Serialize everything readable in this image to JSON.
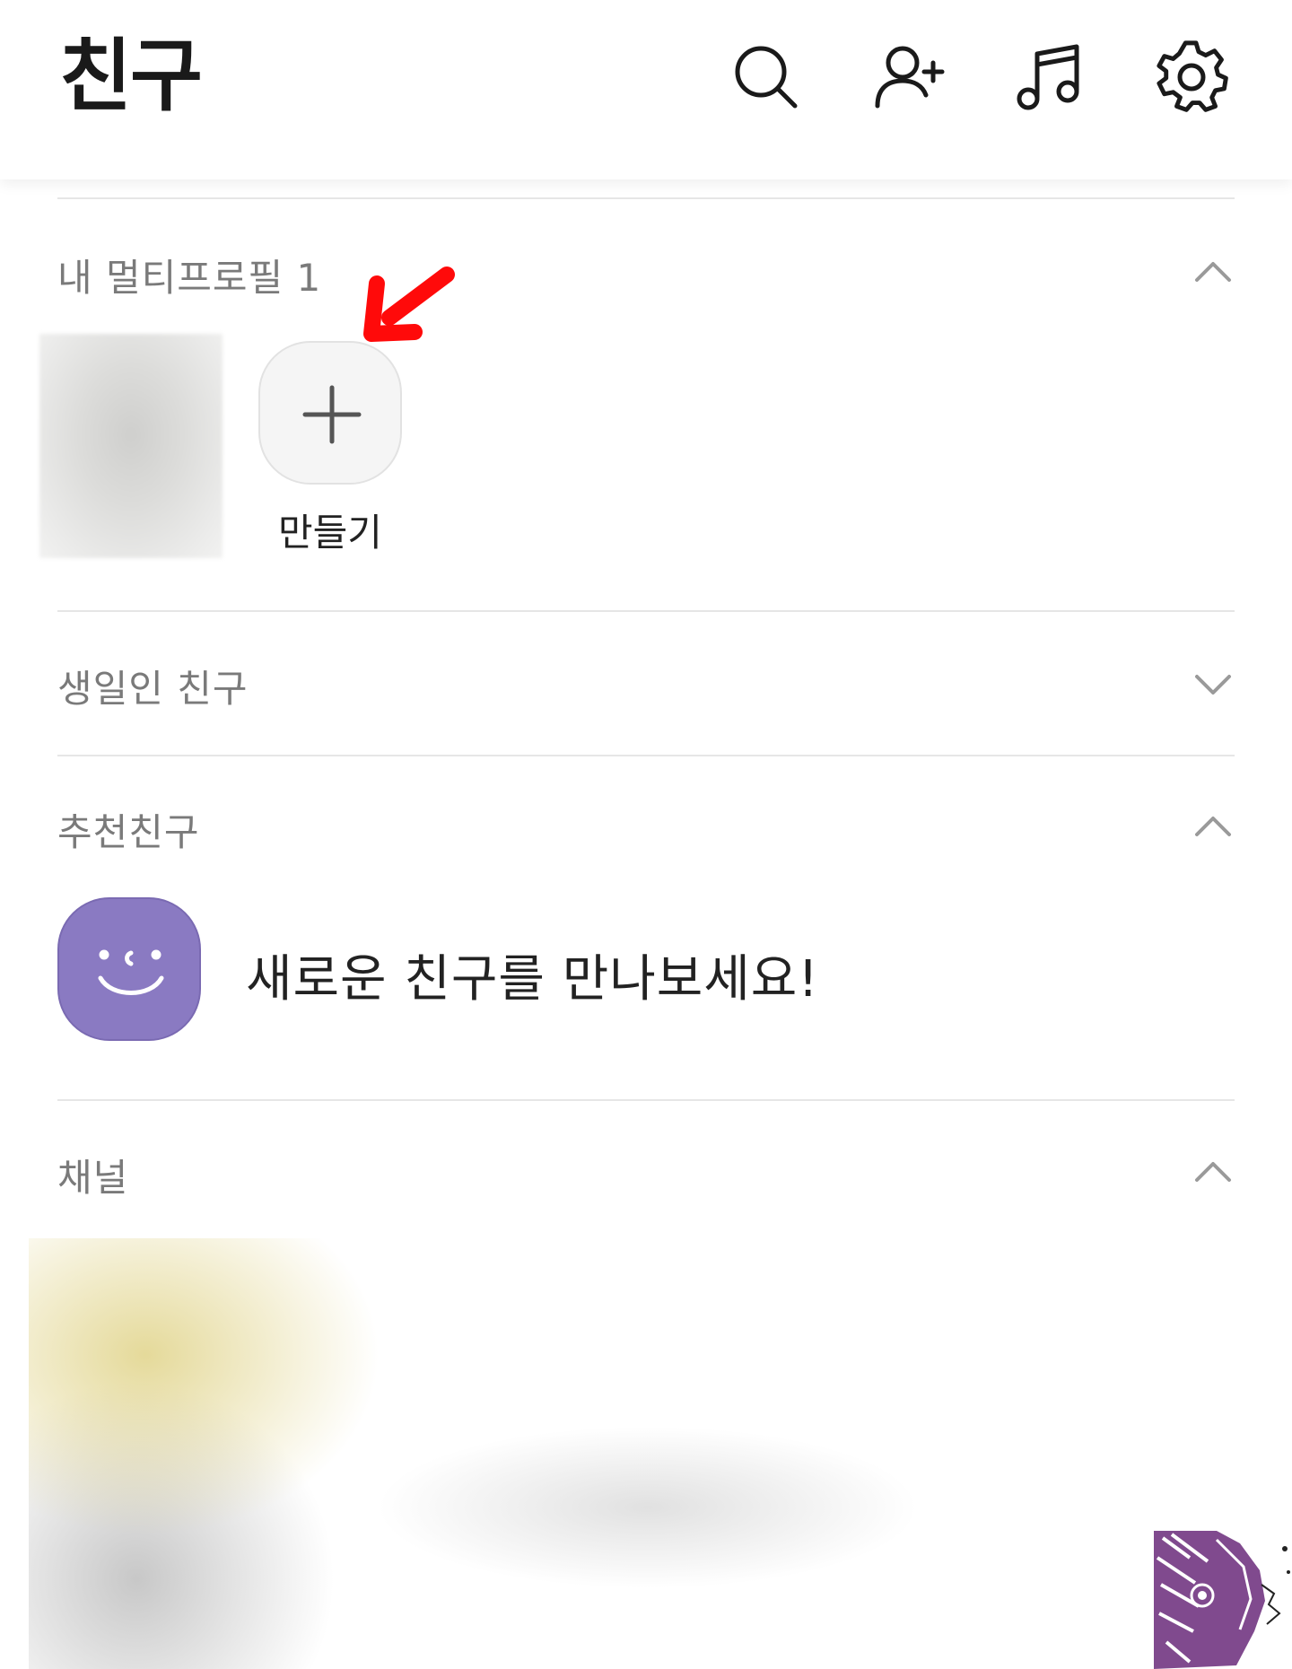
{
  "header": {
    "title": "친구",
    "icons": [
      "search-icon",
      "add-friend-icon",
      "music-icon",
      "settings-icon"
    ]
  },
  "multi_profile": {
    "title": "내 멀티프로필 1",
    "create_label": "만들기",
    "expanded": true
  },
  "birthday": {
    "title": "생일인 친구",
    "expanded": false
  },
  "recommended": {
    "title": "추천친구",
    "message": "새로운 친구를 만나보세요!",
    "expanded": true
  },
  "channel": {
    "title": "채널",
    "expanded": true
  },
  "colors": {
    "accent_purple": "#8a7ac2",
    "annotation_red": "#ff0a0a",
    "divider": "#e6e6e6",
    "section_title": "#7a7a7a"
  }
}
